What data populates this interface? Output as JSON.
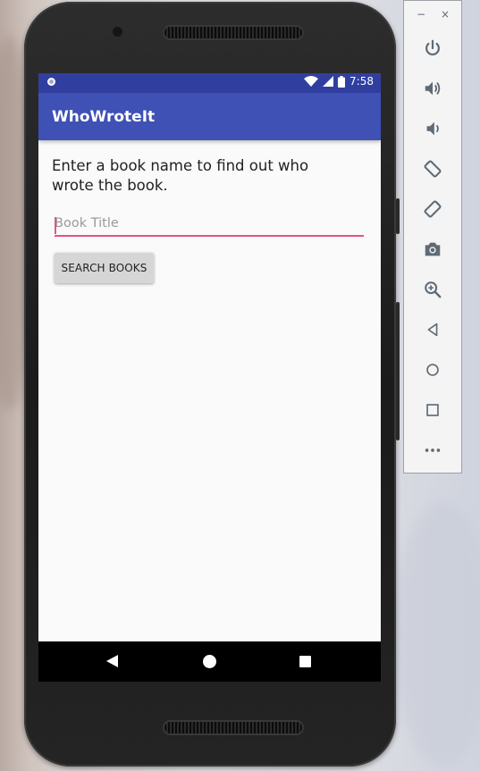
{
  "status_bar": {
    "time": "7:58"
  },
  "app_bar": {
    "title": "WhoWroteIt"
  },
  "main": {
    "instructions": "Enter a book name to find out who wrote the book.",
    "book_input": {
      "placeholder": "Book Title",
      "value": ""
    },
    "search_button_label": "SEARCH BOOKS"
  },
  "emulator_toolbar": {
    "minimize_label": "−",
    "close_label": "×",
    "items": [
      "power-icon",
      "volume-up-icon",
      "volume-down-icon",
      "rotate-left-icon",
      "rotate-right-icon",
      "camera-icon",
      "zoom-icon",
      "back-icon",
      "home-icon",
      "overview-icon",
      "more-icon"
    ]
  },
  "colors": {
    "primary": "#3f51b5",
    "primary_dark": "#303f9f",
    "accent": "#e8518b",
    "toolbar_icon": "#5f6a74"
  }
}
